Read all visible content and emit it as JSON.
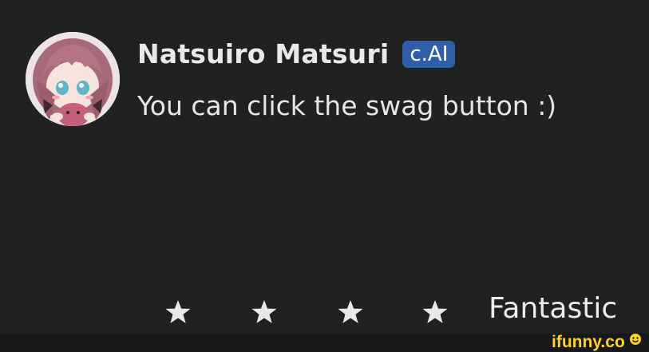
{
  "message_card": {
    "character_name": "Natsuiro Matsuri",
    "badge_label": "c.AI",
    "message_text": "You can click the swag button :)",
    "avatar_icon": "anime-character-avatar"
  },
  "rating": {
    "stars": [
      {
        "icon": "star-icon"
      },
      {
        "icon": "star-icon"
      },
      {
        "icon": "star-icon"
      },
      {
        "icon": "star-icon"
      }
    ],
    "label": "Fantastic"
  },
  "watermark": {
    "logo_text": "ifunny.co"
  },
  "colors": {
    "background": "#202221",
    "badge": "#2f5fa8",
    "text": "#e6e6e6",
    "watermark": "#ffd31a"
  }
}
